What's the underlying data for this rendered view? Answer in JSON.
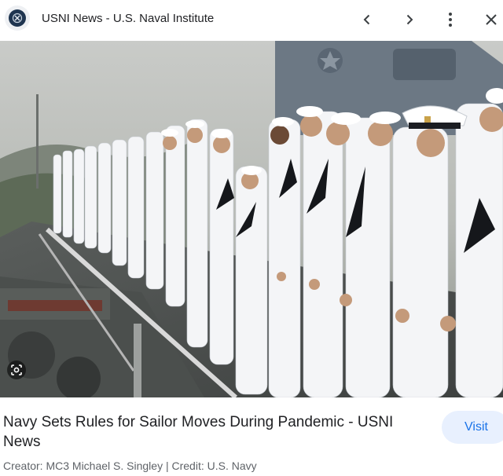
{
  "header": {
    "site_title": "USNI News - U.S. Naval Institute",
    "icons": [
      "site-logo-icon",
      "chevron-left-icon",
      "chevron-right-icon",
      "more-vert-icon",
      "close-icon"
    ]
  },
  "image": {
    "description_icon": "lens-icon"
  },
  "result": {
    "headline": "Navy Sets Rules for Sailor Moves During Pandemic - USNI News",
    "visit_label": "Visit",
    "meta": "Creator: MC3 Michael S. Singley | Credit: U.S. Navy"
  },
  "colors": {
    "accent": "#1a73e8",
    "visit_bg": "#e8f0fe",
    "text": "#202124",
    "muted": "#5f6368"
  }
}
